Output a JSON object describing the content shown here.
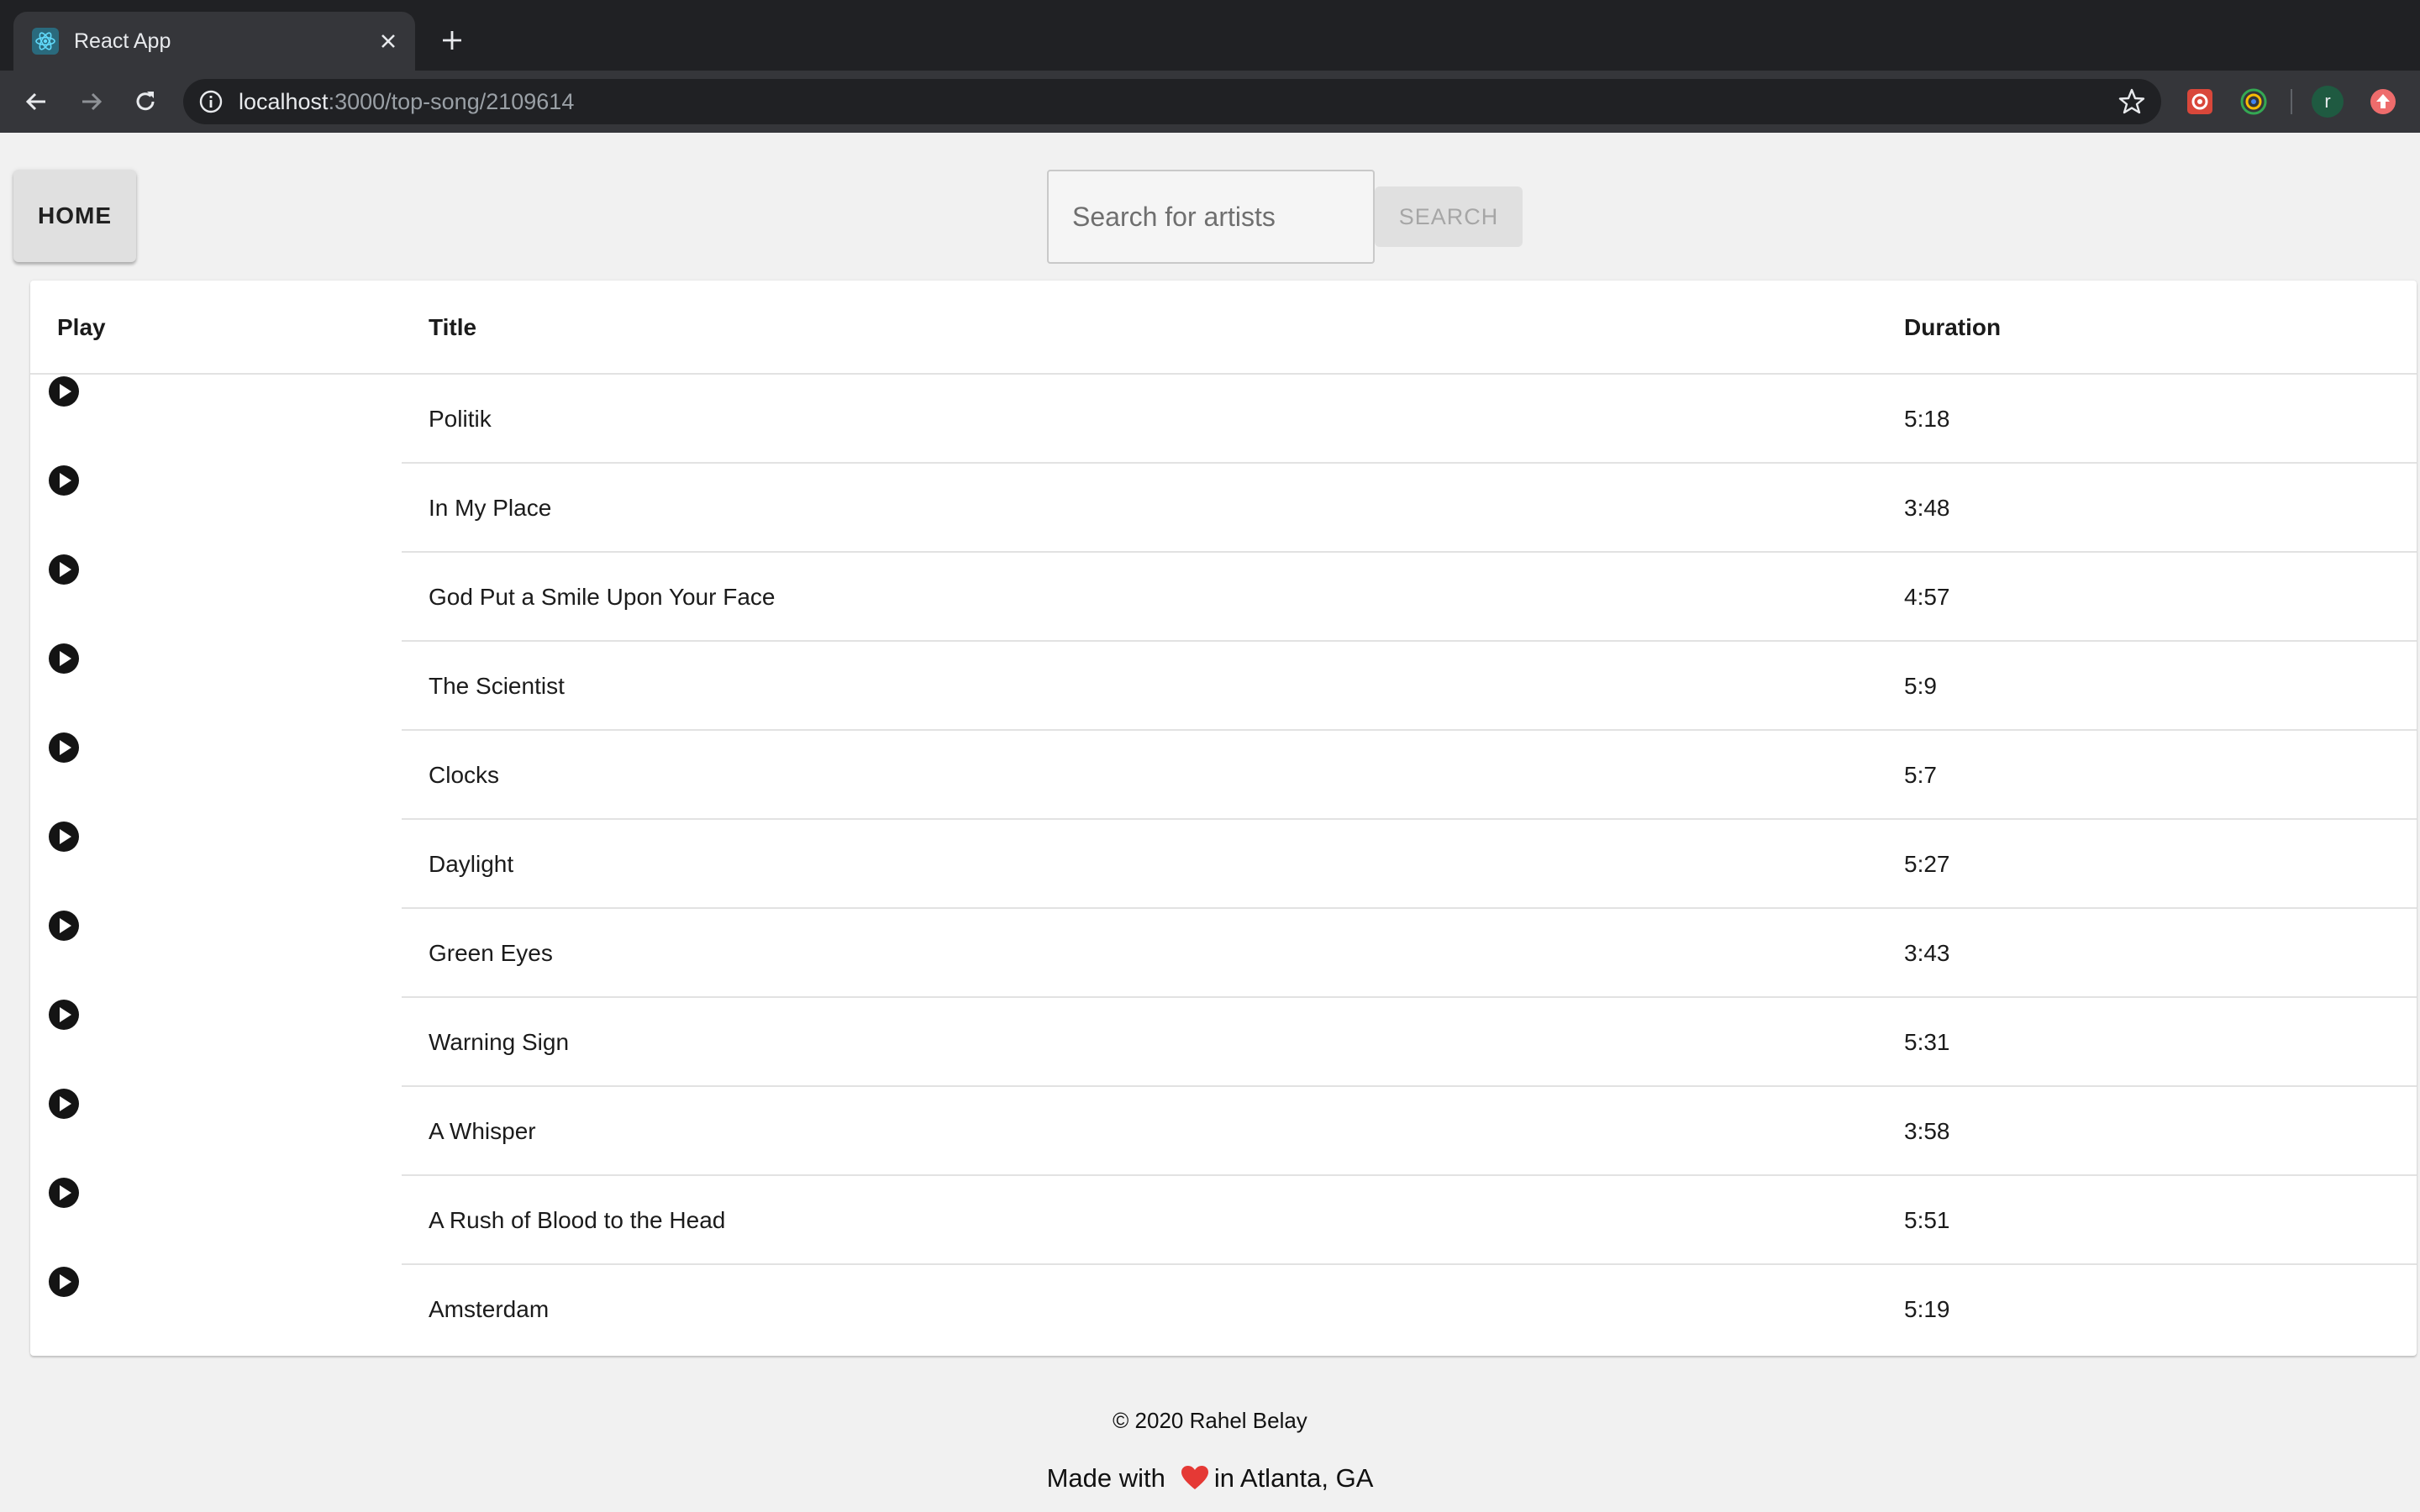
{
  "browser": {
    "tab_title": "React App",
    "url_host": "localhost",
    "url_path": ":3000/top-song/2109614",
    "profile_initial": "r"
  },
  "header": {
    "home_label": "HOME",
    "search_placeholder": "Search for artists",
    "search_label": "SEARCH"
  },
  "table": {
    "columns": {
      "play": "Play",
      "title": "Title",
      "duration": "Duration"
    },
    "rows": [
      {
        "title": "Politik",
        "duration": "5:18"
      },
      {
        "title": "In My Place",
        "duration": "3:48"
      },
      {
        "title": "God Put a Smile Upon Your Face",
        "duration": "4:57"
      },
      {
        "title": "The Scientist",
        "duration": "5:9"
      },
      {
        "title": "Clocks",
        "duration": "5:7"
      },
      {
        "title": "Daylight",
        "duration": "5:27"
      },
      {
        "title": "Green Eyes",
        "duration": "3:43"
      },
      {
        "title": "Warning Sign",
        "duration": "5:31"
      },
      {
        "title": "A Whisper",
        "duration": "3:58"
      },
      {
        "title": "A Rush of Blood to the Head",
        "duration": "5:51"
      },
      {
        "title": "Amsterdam",
        "duration": "5:19"
      }
    ]
  },
  "footer": {
    "copyright": "© 2020 Rahel Belay",
    "made_with": "Made with",
    "location": "in Atlanta, GA"
  },
  "colors": {
    "chrome_dark": "#202124",
    "chrome_toolbar": "#35363a",
    "page_bg": "#f1f1f1",
    "heart": "#e53935"
  }
}
